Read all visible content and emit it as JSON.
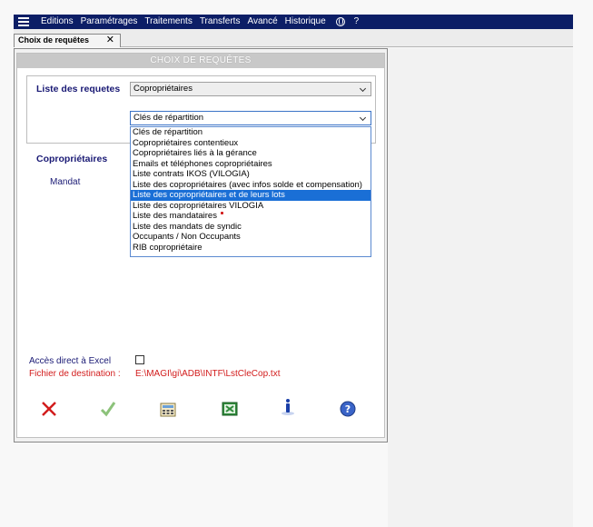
{
  "menu": {
    "items": [
      "Editions",
      "Paramétrages",
      "Traitements",
      "Transferts",
      "Avancé",
      "Historique"
    ],
    "help": "?"
  },
  "tab": {
    "label": "Choix de requêtes",
    "close": "✕"
  },
  "panel": {
    "title": "CHOIX DE REQUÊTES",
    "list_label": "Liste des requetes",
    "list_select_value": "Copropriétaires",
    "sub_select_value": "Clés de répartition",
    "section_label": "Copropriétaires",
    "mandat_label": "Mandat",
    "dropdown_options": [
      "Clés de répartition",
      "Copropriétaires contentieux",
      "Copropriétaires liés à la gérance",
      "Emails et téléphones copropriétaires",
      "Liste contrats IKOS (VILOGIA)",
      "Liste des copropriétaires (avec infos solde et compensation)",
      "Liste des copropriétaires et de leurs lots",
      "Liste des copropriétaires VILOGIA",
      "Liste des mandataires",
      "Liste des mandats de syndic",
      "Occupants / Non Occupants",
      "RIB copropriétaire"
    ],
    "dropdown_selected_index": 6,
    "excel_label": "Accès direct à Excel",
    "excel_checked": false,
    "dest_label": "Fichier de destination :",
    "dest_value": "E:\\MAGI\\gi\\ADB\\INTF\\LstCleCop.txt"
  },
  "toolbar": {
    "icons": [
      "close-icon",
      "check-icon",
      "calculator-icon",
      "excel-icon",
      "info-icon",
      "help-icon"
    ]
  },
  "colors": {
    "menubar": "#0c1e66",
    "accent_blue": "#1a6fd6",
    "label_blue": "#1a1a75",
    "error_red": "#d21c1c",
    "excel_green": "#2f8a3a"
  }
}
